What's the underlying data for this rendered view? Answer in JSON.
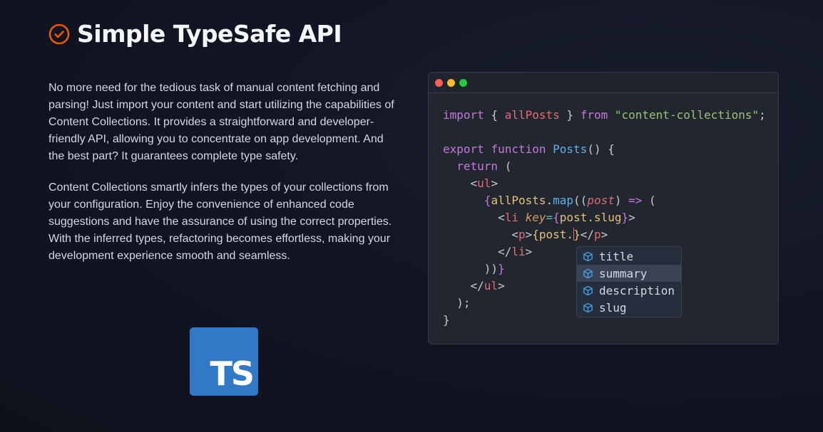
{
  "heading": {
    "title": "Simple TypeSafe API",
    "icon": "check-circle-icon",
    "icon_color": "#ea580c"
  },
  "copy": {
    "paragraph1": "No more need for the tedious task of manual content fetching and parsing! Just import your content and start utilizing the capabilities of Content Collections. It provides a straightforward and developer-friendly API, allowing you to concentrate on app development. And the best part? It guarantees complete type safety.",
    "paragraph2": "Content Collections smartly infers the types of your collections from your configuration. Enjoy the convenience of enhanced code suggestions and have the assurance of using the correct properties. With the inferred types, refactoring becomes effortless, making your development experience smooth and seamless."
  },
  "logo": {
    "text": "TS",
    "color": "#3178c6"
  },
  "editor": {
    "window_controls": [
      {
        "name": "close",
        "color": "#ff5f57"
      },
      {
        "name": "minimize",
        "color": "#febc2e"
      },
      {
        "name": "maximize",
        "color": "#28c840"
      }
    ],
    "code": {
      "import_kw": "import",
      "import_binding": "allPosts",
      "from_kw": "from",
      "module": "\"content-collections\"",
      "export_kw": "export",
      "function_kw": "function",
      "fn_name": "Posts",
      "return_kw": "return",
      "ul_tag": "ul",
      "map_target": "allPosts",
      "map_method": "map",
      "param": "post",
      "li_tag": "li",
      "key_attr": "key",
      "key_value": "post.slug",
      "p_tag": "p",
      "typed_expr": "post."
    },
    "autocomplete": {
      "icon": "cube-icon",
      "items": [
        "title",
        "summary",
        "description",
        "slug"
      ],
      "selected": "summary"
    }
  },
  "colors": {
    "background": "#121624",
    "editor_bg": "#22262f",
    "keyword": "#c678dd",
    "function": "#61afef",
    "string": "#98c379",
    "tag": "#e06c75",
    "variable": "#e5c07b"
  }
}
